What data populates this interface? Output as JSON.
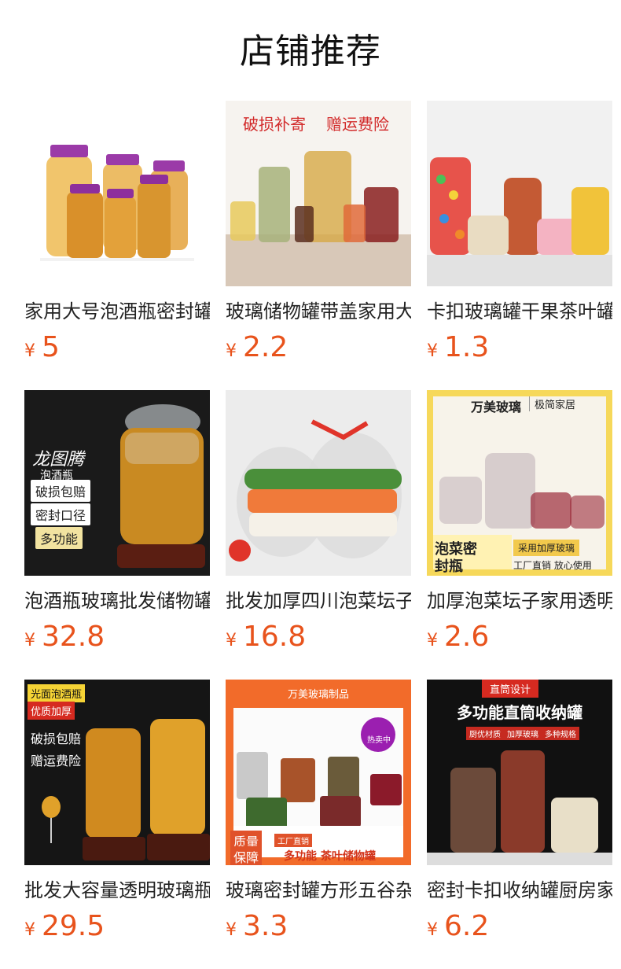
{
  "page": {
    "title": "店铺推荐"
  },
  "products": [
    {
      "name": "家用大号泡酒瓶密封罐",
      "currency": "¥",
      "price": "5",
      "image": {
        "overlay": []
      }
    },
    {
      "name": "玻璃储物罐带盖家用大",
      "currency": "¥",
      "price": "2.2",
      "image": {
        "overlay": [
          "破损补寄",
          "赠运费险"
        ]
      }
    },
    {
      "name": "卡扣玻璃罐干果茶叶罐",
      "currency": "¥",
      "price": "1.3",
      "image": {
        "overlay": []
      }
    },
    {
      "name": "泡酒瓶玻璃批发储物罐",
      "currency": "¥",
      "price": "32.8",
      "image": {
        "overlay": [
          "龙图腾",
          "泡酒瓶",
          "破损包赔",
          "密封口径",
          "多功能"
        ]
      }
    },
    {
      "name": "批发加厚四川泡菜坛子",
      "currency": "¥",
      "price": "16.8",
      "image": {
        "overlay": []
      }
    },
    {
      "name": "加厚泡菜坛子家用透明",
      "currency": "¥",
      "price": "2.6",
      "image": {
        "overlay": [
          "万美玻璃",
          "极简家居",
          "泡菜密",
          "封瓶",
          "采用加厚玻璃",
          "工厂直销 放心使用"
        ]
      }
    },
    {
      "name": "批发大容量透明玻璃瓶",
      "currency": "¥",
      "price": "29.5",
      "image": {
        "overlay": [
          "光面泡酒瓶",
          "优质加厚",
          "破损包赔",
          "赠运费险"
        ]
      }
    },
    {
      "name": "玻璃密封罐方形五谷杂",
      "currency": "¥",
      "price": "3.3",
      "image": {
        "overlay": [
          "万美玻璃制品",
          "热卖中",
          "质量",
          "保障",
          "工厂直销",
          "多功能 茶叶储物罐"
        ]
      }
    },
    {
      "name": "密封卡扣收纳罐厨房家",
      "currency": "¥",
      "price": "6.2",
      "image": {
        "overlay": [
          "直筒设计",
          "多功能直筒收纳罐",
          "厨优材质",
          "加厚玻璃",
          "多种规格"
        ]
      }
    }
  ]
}
